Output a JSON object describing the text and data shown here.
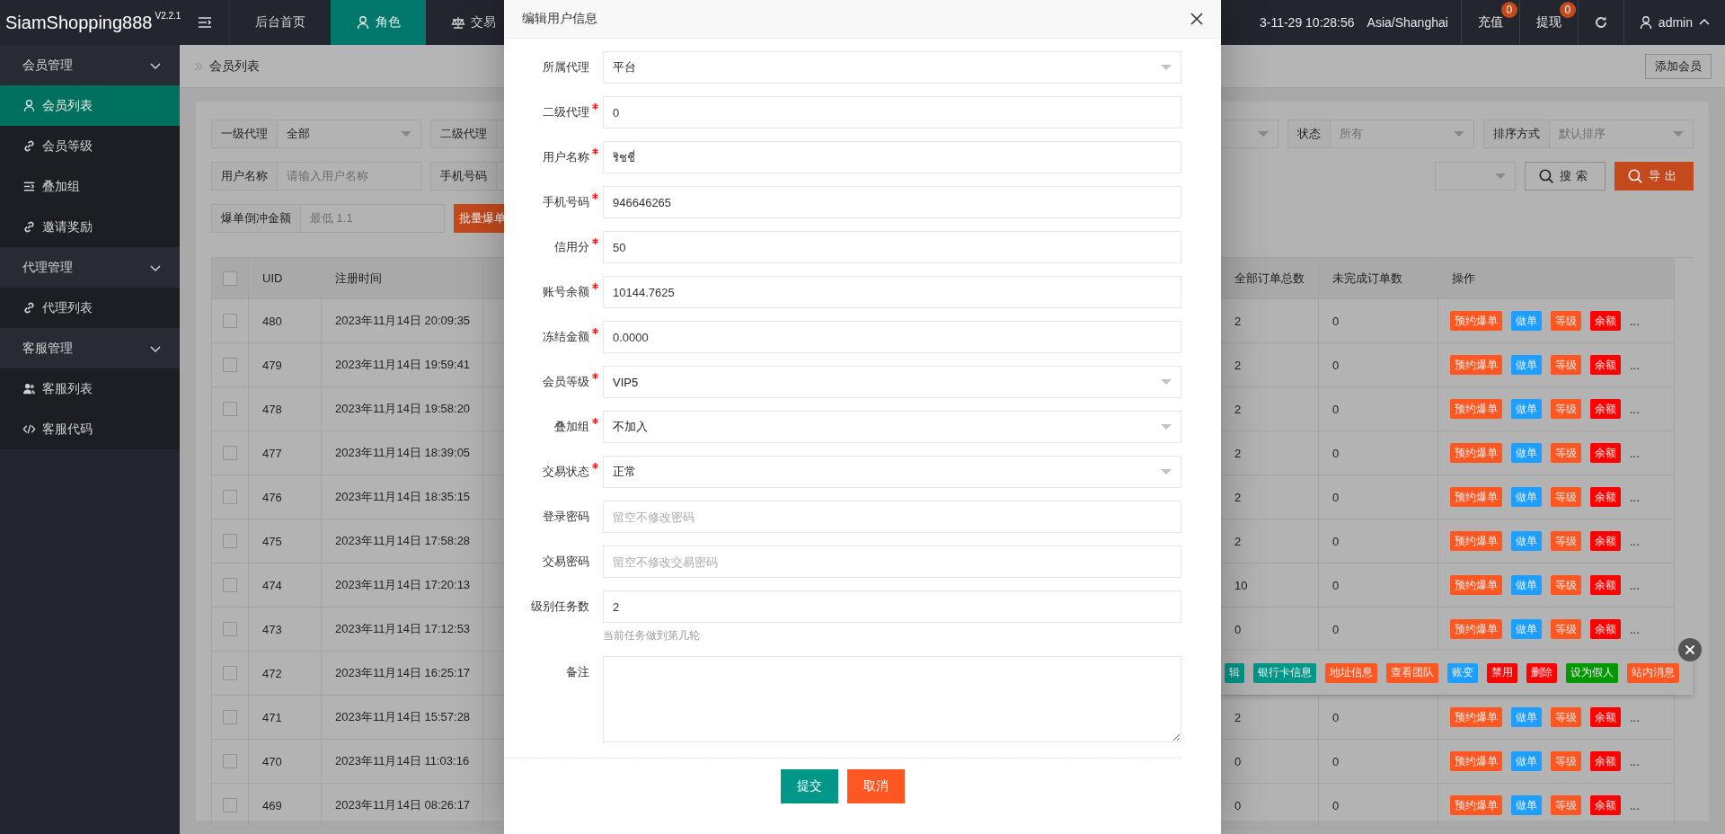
{
  "header": {
    "logo": "SiamShopping888",
    "version": "V2.2.1",
    "nav": [
      {
        "label": "后台首页",
        "selected": false
      },
      {
        "label": "角色",
        "selected": true
      },
      {
        "label": "交易",
        "selected": false
      }
    ],
    "datetime": "3-11-29 10:28:56",
    "timezone": "Asia/Shanghai",
    "actions": [
      {
        "label": "充值",
        "badge": "0"
      },
      {
        "label": "提现",
        "badge": "0"
      }
    ],
    "user": "admin"
  },
  "sidebar": [
    {
      "label": "会员管理",
      "expanded": true,
      "children": [
        {
          "label": "会员列表",
          "selected": true
        },
        {
          "label": "会员等级",
          "selected": false
        },
        {
          "label": "叠加组",
          "selected": false
        },
        {
          "label": "邀请奖励",
          "selected": false
        }
      ]
    },
    {
      "label": "代理管理",
      "expanded": true,
      "children": [
        {
          "label": "代理列表",
          "selected": false
        }
      ]
    },
    {
      "label": "客服管理",
      "expanded": true,
      "children": [
        {
          "label": "客服列表",
          "selected": false
        },
        {
          "label": "客服代码",
          "selected": false
        }
      ]
    }
  ],
  "breadcrumb": "会员列表",
  "add_button": "添加会员",
  "filters": [
    {
      "left": [
        {
          "kind": "select",
          "label": "一级代理",
          "value": "全部"
        },
        {
          "kind": "label",
          "label": "二级代理"
        }
      ],
      "right": [
        {
          "kind": "select"
        },
        {
          "kind": "select",
          "label": "状态",
          "placeholder": "所有"
        },
        {
          "kind": "select",
          "label": "排序方式",
          "placeholder": "默认排序"
        }
      ]
    },
    {
      "left": [
        {
          "kind": "input",
          "label": "用户名称",
          "placeholder": "请输入用户名称"
        },
        {
          "kind": "label",
          "label": "手机号码"
        }
      ],
      "right": [
        {
          "kind": "select"
        },
        {
          "kind": "search_button",
          "label": "搜索"
        },
        {
          "kind": "export_button",
          "label": "导出"
        }
      ]
    },
    {
      "left": [
        {
          "kind": "input",
          "label": "爆单倒冲金额",
          "placeholder": "最低 1.1"
        },
        {
          "kind": "batch_button",
          "label": "批量爆单"
        }
      ]
    }
  ],
  "table": {
    "header_checked": false,
    "columns": [
      "UID",
      "注册时间",
      "全部订单总数",
      "未完成订单数",
      "操作"
    ],
    "rows": [
      {
        "checked": false,
        "uid": "480",
        "registered": "2023年11月14日 20:09:35",
        "total_orders": "2",
        "open_orders": "0",
        "actions": [
          {
            "label": "预约爆单",
            "color": "#ff5722"
          },
          {
            "label": "做单",
            "color": "#1e9fff"
          },
          {
            "label": "等级",
            "color": "#ff5722"
          },
          {
            "label": "余额",
            "color": "#ff0000"
          }
        ],
        "more": "..."
      },
      {
        "checked": false,
        "uid": "479",
        "registered": "2023年11月14日 19:59:41",
        "total_orders": "2",
        "open_orders": "0",
        "actions": [
          {
            "label": "预约爆单",
            "color": "#ff5722"
          },
          {
            "label": "做单",
            "color": "#1e9fff"
          },
          {
            "label": "等级",
            "color": "#ff5722"
          },
          {
            "label": "余额",
            "color": "#ff0000"
          }
        ],
        "more": "..."
      },
      {
        "checked": false,
        "uid": "478",
        "registered": "2023年11月14日 19:58:20",
        "total_orders": "2",
        "open_orders": "0",
        "actions": [
          {
            "label": "预约爆单",
            "color": "#ff5722"
          },
          {
            "label": "做单",
            "color": "#1e9fff"
          },
          {
            "label": "等级",
            "color": "#ff5722"
          },
          {
            "label": "余额",
            "color": "#ff0000"
          }
        ],
        "more": "..."
      },
      {
        "checked": false,
        "uid": "477",
        "registered": "2023年11月14日 18:39:05",
        "total_orders": "2",
        "open_orders": "0",
        "actions": [
          {
            "label": "预约爆单",
            "color": "#ff5722"
          },
          {
            "label": "做单",
            "color": "#1e9fff"
          },
          {
            "label": "等级",
            "color": "#ff5722"
          },
          {
            "label": "余额",
            "color": "#ff0000"
          }
        ],
        "more": "..."
      },
      {
        "checked": false,
        "uid": "476",
        "registered": "2023年11月14日 18:35:15",
        "total_orders": "2",
        "open_orders": "0",
        "actions": [
          {
            "label": "预约爆单",
            "color": "#ff5722"
          },
          {
            "label": "做单",
            "color": "#1e9fff"
          },
          {
            "label": "等级",
            "color": "#ff5722"
          },
          {
            "label": "余额",
            "color": "#ff0000"
          }
        ],
        "more": "..."
      },
      {
        "checked": false,
        "uid": "475",
        "registered": "2023年11月14日 17:58:28",
        "total_orders": "2",
        "open_orders": "0",
        "actions": [
          {
            "label": "预约爆单",
            "color": "#ff5722"
          },
          {
            "label": "做单",
            "color": "#1e9fff"
          },
          {
            "label": "等级",
            "color": "#ff5722"
          },
          {
            "label": "余额",
            "color": "#ff0000"
          }
        ],
        "more": "..."
      },
      {
        "checked": false,
        "uid": "474",
        "registered": "2023年11月14日 17:20:13",
        "total_orders": "10",
        "open_orders": "0",
        "actions": [
          {
            "label": "预约爆单",
            "color": "#ff5722"
          },
          {
            "label": "做单",
            "color": "#1e9fff"
          },
          {
            "label": "等级",
            "color": "#ff5722"
          },
          {
            "label": "余额",
            "color": "#ff0000"
          }
        ],
        "more": "..."
      },
      {
        "checked": false,
        "uid": "473",
        "registered": "2023年11月14日 17:12:53",
        "total_orders": "0",
        "open_orders": "0",
        "actions": [
          {
            "label": "预约爆单",
            "color": "#ff5722"
          },
          {
            "label": "做单",
            "color": "#1e9fff"
          },
          {
            "label": "等级",
            "color": "#ff5722"
          },
          {
            "label": "余额",
            "color": "#ff0000"
          }
        ],
        "more": "..."
      },
      {
        "checked": false,
        "uid": "472",
        "registered": "2023年11月14日 16:25:17",
        "menu": [
          {
            "label": "辑",
            "color": "#009688"
          },
          {
            "label": "银行卡信息",
            "color": "#009688"
          },
          {
            "label": "地址信息",
            "color": "#ff5722"
          },
          {
            "label": "查看团队",
            "color": "#ff5722"
          },
          {
            "label": "账变",
            "color": "#1e9fff"
          },
          {
            "label": "禁用",
            "color": "#ff0000"
          },
          {
            "label": "删除",
            "color": "#ff0000"
          },
          {
            "label": "设为假人",
            "color": "#009900"
          },
          {
            "label": "站内消息",
            "color": "#ff5722"
          }
        ]
      },
      {
        "checked": false,
        "uid": "471",
        "registered": "2023年11月14日 15:57:28",
        "total_orders": "2",
        "open_orders": "0",
        "actions": [
          {
            "label": "预约爆单",
            "color": "#ff5722"
          },
          {
            "label": "做单",
            "color": "#1e9fff"
          },
          {
            "label": "等级",
            "color": "#ff5722"
          },
          {
            "label": "余额",
            "color": "#ff0000"
          }
        ],
        "more": "..."
      },
      {
        "checked": false,
        "uid": "470",
        "registered": "2023年11月14日 11:03:16",
        "total_orders": "0",
        "open_orders": "0",
        "actions": [
          {
            "label": "预约爆单",
            "color": "#ff5722"
          },
          {
            "label": "做单",
            "color": "#1e9fff"
          },
          {
            "label": "等级",
            "color": "#ff5722"
          },
          {
            "label": "余额",
            "color": "#ff0000"
          }
        ],
        "more": "..."
      },
      {
        "checked": false,
        "uid": "469",
        "registered": "2023年11月14日 08:26:17",
        "total_orders": "0",
        "open_orders": "0",
        "actions": [
          {
            "label": "预约爆单",
            "color": "#ff5722"
          },
          {
            "label": "做单",
            "color": "#1e9fff"
          },
          {
            "label": "等级",
            "color": "#ff5722"
          },
          {
            "label": "余额",
            "color": "#ff0000"
          }
        ],
        "more": "..."
      }
    ]
  },
  "modal": {
    "title": "编辑用户信息",
    "fields": [
      {
        "label": "所属代理",
        "required": false,
        "kind": "select",
        "value": "平台"
      },
      {
        "label": "二级代理",
        "required": true,
        "kind": "input",
        "value": "0"
      },
      {
        "label": "用户名称",
        "required": true,
        "kind": "input",
        "value": "ริชชี่"
      },
      {
        "label": "手机号码",
        "required": true,
        "kind": "input",
        "value": "946646265"
      },
      {
        "label": "信用分",
        "required": true,
        "kind": "input",
        "value": "50"
      },
      {
        "label": "账号余额",
        "required": true,
        "kind": "input",
        "value": "10144.7625"
      },
      {
        "label": "冻结金额",
        "required": true,
        "kind": "input",
        "value": "0.0000"
      },
      {
        "label": "会员等级",
        "required": true,
        "kind": "select",
        "value": "VIP5"
      },
      {
        "label": "叠加组",
        "required": true,
        "kind": "select",
        "value": "不加入"
      },
      {
        "label": "交易状态",
        "required": true,
        "kind": "select",
        "value": "正常"
      },
      {
        "label": "登录密码",
        "required": false,
        "kind": "input",
        "placeholder": "留空不修改密码"
      },
      {
        "label": "交易密码",
        "required": false,
        "kind": "input",
        "placeholder": "留空不修改交易密码"
      },
      {
        "label": "级别任务数",
        "required": false,
        "kind": "input",
        "value": "2",
        "hint": "当前任务做到第几轮"
      },
      {
        "label": "备注",
        "required": false,
        "kind": "textarea"
      }
    ],
    "buttons": [
      {
        "label": "提交",
        "kind": "primary"
      },
      {
        "label": "取消",
        "kind": "danger"
      }
    ]
  }
}
